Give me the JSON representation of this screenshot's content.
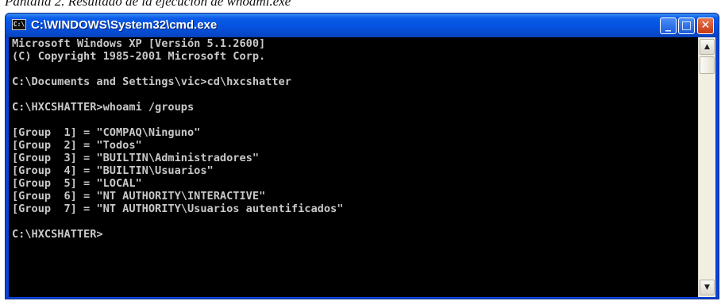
{
  "caption": "Pantalla 2. Resultado de la ejecución de whoami.exe",
  "window": {
    "title": "C:\\WINDOWS\\System32\\cmd.exe",
    "icon_label": "C:\\",
    "buttons": {
      "minimize": "_",
      "maximize": "□",
      "close": "✕"
    }
  },
  "console": {
    "lines": [
      "Microsoft Windows XP [Versión 5.1.2600]",
      "(C) Copyright 1985-2001 Microsoft Corp.",
      "",
      "C:\\Documents and Settings\\vic>cd\\hxcshatter",
      "",
      "C:\\HXCSHATTER>whoami /groups",
      "",
      "[Group  1] = \"COMPAQ\\Ninguno\"",
      "[Group  2] = \"Todos\"",
      "[Group  3] = \"BUILTIN\\Administradores\"",
      "[Group  4] = \"BUILTIN\\Usuarios\"",
      "[Group  5] = \"LOCAL\"",
      "[Group  6] = \"NT AUTHORITY\\INTERACTIVE\"",
      "[Group  7] = \"NT AUTHORITY\\Usuarios autentificados\"",
      "",
      "C:\\HXCSHATTER>"
    ]
  },
  "scrollbar": {
    "up_arrow": "▲",
    "down_arrow": "▼"
  },
  "colors": {
    "titlebar": "#0552e0",
    "console_background": "#000000",
    "console_text": "#c8c8c8",
    "close_button": "#c43a14"
  }
}
